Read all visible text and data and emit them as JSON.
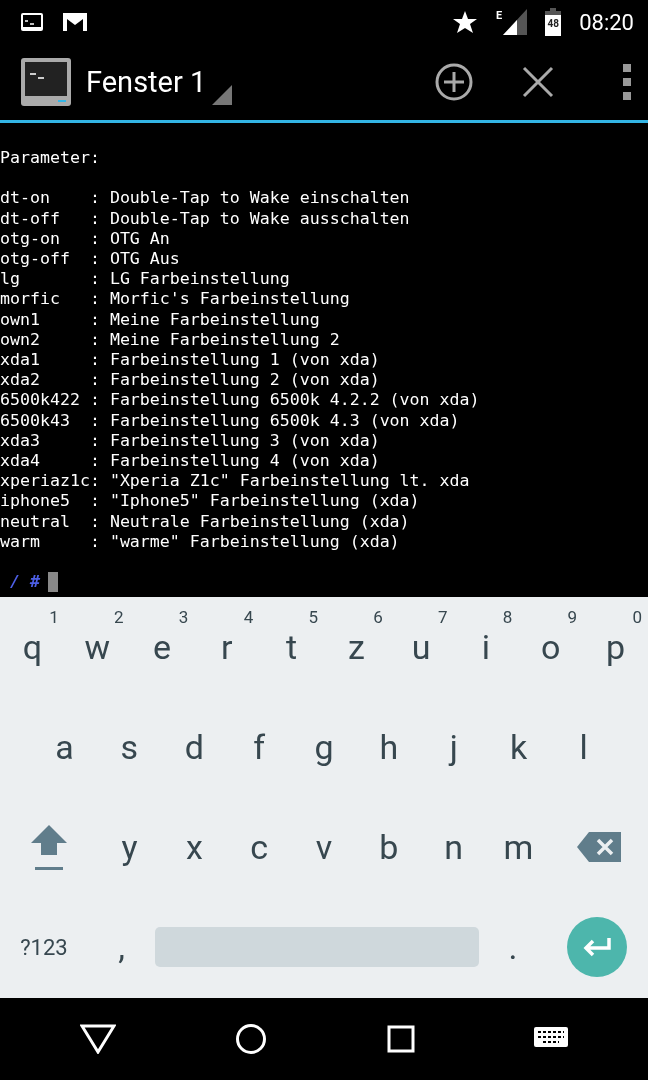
{
  "status_bar": {
    "network": "E",
    "battery": "48",
    "time": "08:20"
  },
  "action_bar": {
    "title": "Fenster 1"
  },
  "terminal": {
    "header": "Parameter:",
    "lines": [
      "dt-on    : Double-Tap to Wake einschalten",
      "dt-off   : Double-Tap to Wake ausschalten",
      "otg-on   : OTG An",
      "otg-off  : OTG Aus",
      "lg       : LG Farbeinstellung",
      "morfic   : Morfic's Farbeinstellung",
      "own1     : Meine Farbeinstellung",
      "own2     : Meine Farbeinstellung 2",
      "xda1     : Farbeinstellung 1 (von xda)",
      "xda2     : Farbeinstellung 2 (von xda)",
      "6500k422 : Farbeinstellung 6500k 4.2.2 (von xda)",
      "6500k43  : Farbeinstellung 6500k 4.3 (von xda)",
      "xda3     : Farbeinstellung 3 (von xda)",
      "xda4     : Farbeinstellung 4 (von xda)",
      "xperiaz1c: \"Xperia Z1c\" Farbeinstellung lt. xda",
      "iphone5  : \"Iphone5\" Farbeinstellung (xda)",
      "neutral  : Neutrale Farbeinstellung (xda)",
      "warm     : \"warme\" Farbeinstellung (xda)"
    ],
    "prompt": "/ #"
  },
  "keyboard": {
    "rows": [
      {
        "keys": [
          {
            "kind": "letter",
            "label": "q",
            "hint": "1"
          },
          {
            "kind": "letter",
            "label": "w",
            "hint": "2"
          },
          {
            "kind": "letter",
            "label": "e",
            "hint": "3"
          },
          {
            "kind": "letter",
            "label": "r",
            "hint": "4"
          },
          {
            "kind": "letter",
            "label": "t",
            "hint": "5"
          },
          {
            "kind": "letter",
            "label": "z",
            "hint": "6"
          },
          {
            "kind": "letter",
            "label": "u",
            "hint": "7"
          },
          {
            "kind": "letter",
            "label": "i",
            "hint": "8"
          },
          {
            "kind": "letter",
            "label": "o",
            "hint": "9"
          },
          {
            "kind": "letter",
            "label": "p",
            "hint": "0"
          }
        ]
      },
      {
        "keys": [
          {
            "kind": "letter",
            "label": "a"
          },
          {
            "kind": "letter",
            "label": "s"
          },
          {
            "kind": "letter",
            "label": "d"
          },
          {
            "kind": "letter",
            "label": "f"
          },
          {
            "kind": "letter",
            "label": "g"
          },
          {
            "kind": "letter",
            "label": "h"
          },
          {
            "kind": "letter",
            "label": "j"
          },
          {
            "kind": "letter",
            "label": "k"
          },
          {
            "kind": "letter",
            "label": "l"
          }
        ]
      },
      {
        "keys": [
          {
            "kind": "shift"
          },
          {
            "kind": "letter",
            "label": "y"
          },
          {
            "kind": "letter",
            "label": "x"
          },
          {
            "kind": "letter",
            "label": "c"
          },
          {
            "kind": "letter",
            "label": "v"
          },
          {
            "kind": "letter",
            "label": "b"
          },
          {
            "kind": "letter",
            "label": "n"
          },
          {
            "kind": "letter",
            "label": "m"
          },
          {
            "kind": "backspace"
          }
        ]
      },
      {
        "keys": [
          {
            "kind": "symbols",
            "label": "?123"
          },
          {
            "kind": "punct",
            "label": ","
          },
          {
            "kind": "space"
          },
          {
            "kind": "punct",
            "label": "."
          },
          {
            "kind": "enter"
          }
        ]
      }
    ]
  }
}
